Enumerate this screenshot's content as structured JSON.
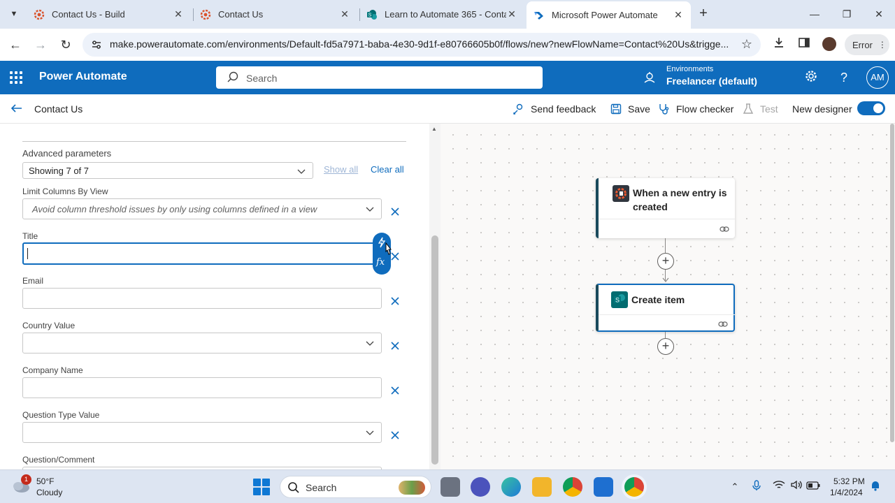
{
  "browser": {
    "tabs": [
      {
        "title": "Contact Us - Build",
        "close": "✕"
      },
      {
        "title": "Contact Us",
        "close": "✕"
      },
      {
        "title": "Learn to Automate 365 - Conta",
        "close": "✕"
      },
      {
        "title": "Microsoft Power Automate",
        "close": "✕"
      }
    ],
    "new_tab": "+",
    "url": "make.powerautomate.com/environments/Default-fd5a7971-baba-4e30-9d1f-e80766605b0f/flows/new?newFlowName=Contact%20Us&trigge...",
    "profile_chip": "Error"
  },
  "app": {
    "name": "Power Automate",
    "search_placeholder": "Search",
    "environment_label": "Environments",
    "environment_name": "Freelancer (default)",
    "avatar_initials": "AM",
    "brand_color": "#0f6cbd"
  },
  "commandbar": {
    "flow_name": "Contact Us",
    "send_feedback": "Send feedback",
    "save": "Save",
    "flow_checker": "Flow checker",
    "test": "Test",
    "new_designer": "New designer",
    "new_designer_on": true
  },
  "panel": {
    "advanced_label": "Advanced parameters",
    "advanced_value": "Showing 7 of 7",
    "show_all": "Show all",
    "clear_all": "Clear all",
    "fields": [
      {
        "label": "Limit Columns By View",
        "placeholder": "Avoid column threshold issues by only using columns defined in a view",
        "type": "dropdown"
      },
      {
        "label": "Title",
        "value": "",
        "type": "text"
      },
      {
        "label": "Email",
        "value": "",
        "type": "text"
      },
      {
        "label": "Country Value",
        "value": "",
        "type": "dropdown"
      },
      {
        "label": "Company Name",
        "value": "",
        "type": "text"
      },
      {
        "label": "Question Type Value",
        "value": "",
        "type": "dropdown"
      },
      {
        "label": "Question/Comment",
        "value": "",
        "type": "text"
      }
    ],
    "fx_label": "fx"
  },
  "canvas": {
    "trigger": {
      "title": "When a new entry is created",
      "icon": "cognito-forms-icon"
    },
    "action": {
      "title": "Create item",
      "icon": "sharepoint-icon"
    }
  },
  "taskbar": {
    "weather_badge": "1",
    "temperature": "50°F",
    "condition": "Cloudy",
    "search_placeholder": "Search",
    "time": "5:32 PM",
    "date": "1/4/2024"
  }
}
